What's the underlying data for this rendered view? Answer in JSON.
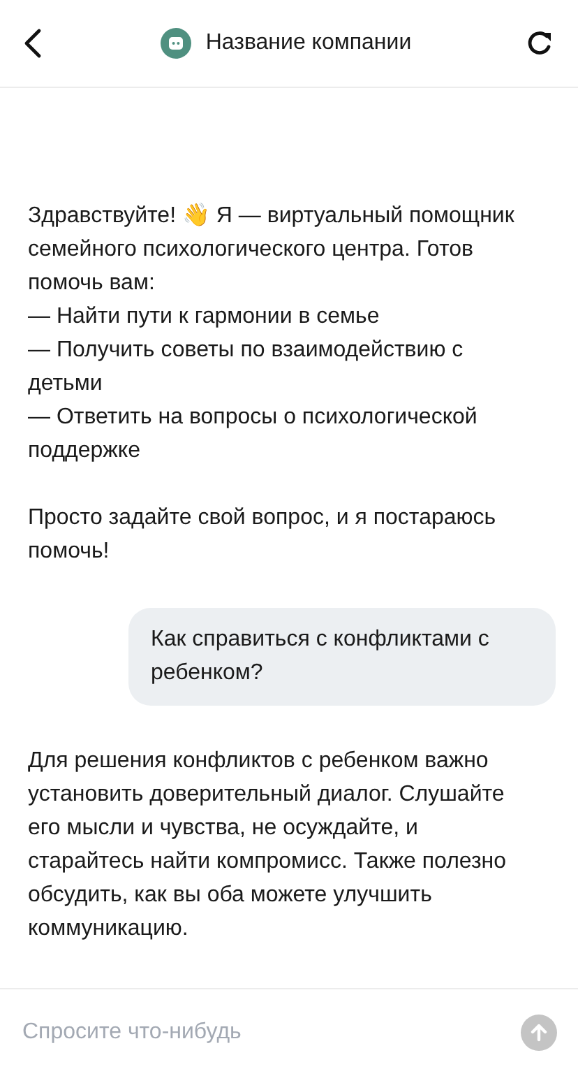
{
  "header": {
    "title": "Название компании"
  },
  "messages": [
    {
      "kind": "bot",
      "paragraphs": [
        [
          "Здравствуйте! 👋 Я — виртуальный помощник семейного психологического центра. Готов помочь вам:",
          "— Найти пути к гармонии в семье",
          "— Получить советы по взаимодействию с детьми",
          "— Ответить на вопросы о психологической поддержке"
        ],
        [
          "Просто задайте свой вопрос, и я постараюсь помочь!"
        ]
      ]
    },
    {
      "kind": "user",
      "paragraphs": [
        [
          "Как справиться с конфликтами с ребенком?"
        ]
      ]
    },
    {
      "kind": "bot",
      "paragraphs": [
        [
          "Для решения конфликтов с ребенком важно установить доверительный диалог. Слушайте его мысли и чувства, не осуждайте, и старайтесь найти компромисс. Также полезно обсудить, как вы оба можете улучшить коммуникацию."
        ]
      ]
    }
  ],
  "composer": {
    "placeholder": "Спросите что-нибудь"
  }
}
